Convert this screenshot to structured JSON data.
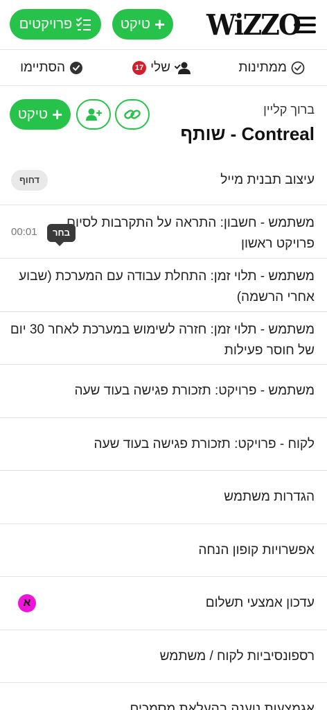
{
  "header": {
    "logo": "WiZZO",
    "projects_label": "פרויקטים",
    "ticket_label": "טיקט"
  },
  "tabs": {
    "pending": "ממתינות",
    "mine": "שלי",
    "mine_count": "17",
    "done": "הסתיימו"
  },
  "client": {
    "greeting": "ברוך קליין",
    "name": "Contreal - שותף",
    "ticket_label": "טיקט"
  },
  "rows": [
    {
      "line1": "עיצוב תבנית מייל",
      "line2": "",
      "pill": "דחוף"
    },
    {
      "line1": "משתמש - חשבון: התראה על התקרבות לסיום",
      "line2": "פרויקט ראשון",
      "time": "00:01",
      "tooltip": "בחר"
    },
    {
      "line1": "משתמש - תלוי זמן: התחלת עבודה עם המערכת (שבוע",
      "line2": "אחרי הרשמה)"
    },
    {
      "line1": "משתמש - תלוי זמן: חזרה לשימוש במערכת לאחר 30 יום",
      "line2": "של חוסר פעילות"
    },
    {
      "line1": "משתמש - פרויקט: תזכורת פגישה בעוד שעה",
      "line2": ""
    },
    {
      "line1": "לקוח - פרויקט: תזכורת פגישה בעוד שעה",
      "line2": ""
    },
    {
      "line1": "הגדרות משתמש",
      "line2": ""
    },
    {
      "line1": "אפשרויות קופון הנחה",
      "line2": ""
    },
    {
      "line1": "עדכון אמצעי תשלום",
      "line2": "",
      "letter": "א"
    },
    {
      "line1": "רספונסיביות לקוח / משתמש",
      "line2": ""
    },
    {
      "line1": "אגמצעות נוענה בהעלאת מסמכים",
      "line2": ""
    }
  ],
  "colors": {
    "accent_green": "#27c24a",
    "badge_red": "#d21f2b",
    "badge_magenta": "#f014d8"
  }
}
